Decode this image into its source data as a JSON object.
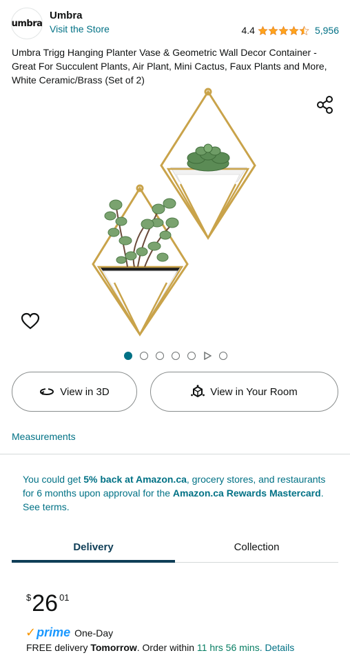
{
  "brand": {
    "logo_text": "umbra",
    "name": "Umbra",
    "visit_store": "Visit the Store"
  },
  "rating": {
    "value": "4.4",
    "stars_out_of_5": 4.4,
    "count": "5,956"
  },
  "product": {
    "title": "Umbra Trigg Hanging Planter Vase & Geometric Wall Decor Container - Great For Succulent Plants, Air Plant, Mini Cactus, Faux Plants and More, White Ceramic/Brass (Set of 2)"
  },
  "gallery": {
    "image_count": 6,
    "active_index": 0,
    "video_index": 4,
    "icons": [
      "share-icon",
      "heart-icon",
      "play-icon"
    ]
  },
  "actions": {
    "view_3d": "View in 3D",
    "view_room": "View in Your Room"
  },
  "measurements": "Measurements",
  "promo": {
    "p1": "You could get ",
    "b1": "5% back at Amazon.ca",
    "p2": ", grocery stores, and restaurants for 6 months upon approval for the ",
    "b2": "Amazon.ca Rewards Mastercard",
    "p3": ". See terms."
  },
  "tabs": {
    "delivery": "Delivery",
    "collection": "Collection",
    "active": "Delivery"
  },
  "price": {
    "symbol": "$",
    "whole": "26",
    "fraction": "01"
  },
  "prime": {
    "check": "✓",
    "logo": "prime",
    "speed": "One-Day"
  },
  "delivery": {
    "free_text": "FREE delivery ",
    "day": "Tomorrow",
    "order_within": ". Order within ",
    "countdown": "11 hrs 56 mins",
    "details": ". Details"
  },
  "colors": {
    "link": "#007185",
    "tab_active": "#0f3e57",
    "star": "#ffa41c",
    "prime_blue": "#1a98ff",
    "countdown": "#067d62",
    "brass": "#c9a34a"
  }
}
